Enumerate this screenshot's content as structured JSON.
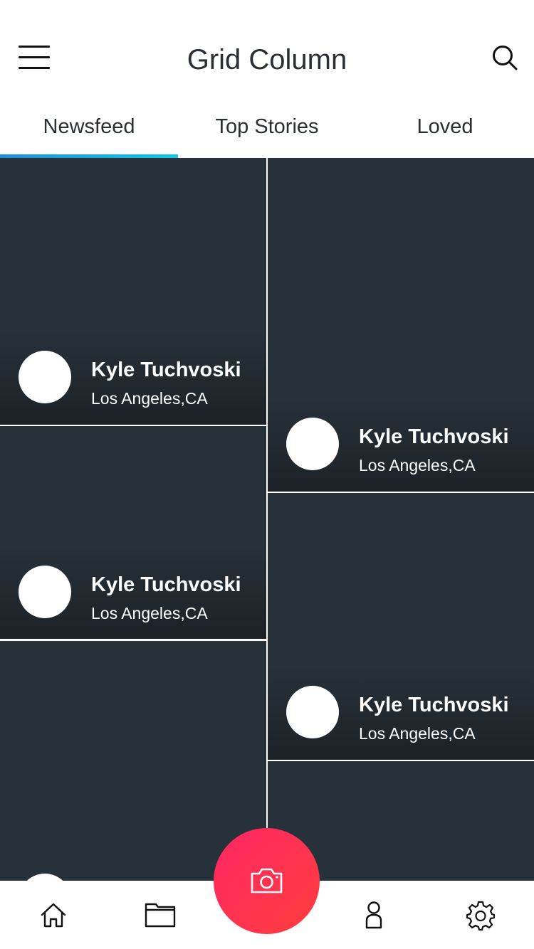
{
  "header": {
    "title": "Grid Column",
    "menu_icon": "hamburger-menu-icon",
    "search_icon": "search-icon"
  },
  "tabs": [
    {
      "label": "Newsfeed",
      "active": true
    },
    {
      "label": "Top Stories",
      "active": false
    },
    {
      "label": "Loved",
      "active": false
    }
  ],
  "feed": {
    "left_column": [
      {
        "name": "Kyle Tuchvoski",
        "location": "Los Angeles,CA"
      },
      {
        "name": "Kyle Tuchvoski",
        "location": "Los Angeles,CA"
      }
    ],
    "right_column": [
      {
        "name": "Kyle Tuchvoski",
        "location": "Los Angeles,CA"
      },
      {
        "name": "Kyle Tuchvoski",
        "location": "Los Angeles,CA"
      }
    ]
  },
  "bottom_nav": {
    "items": [
      "home-icon",
      "folder-icon",
      "camera-icon",
      "profile-icon",
      "settings-icon"
    ]
  },
  "colors": {
    "card_background": "#273139",
    "accent_gradient_start": "#1d8fe0",
    "accent_gradient_end": "#12c9e6",
    "fab_start": "#ff2764",
    "fab_end": "#ff3d3d"
  }
}
